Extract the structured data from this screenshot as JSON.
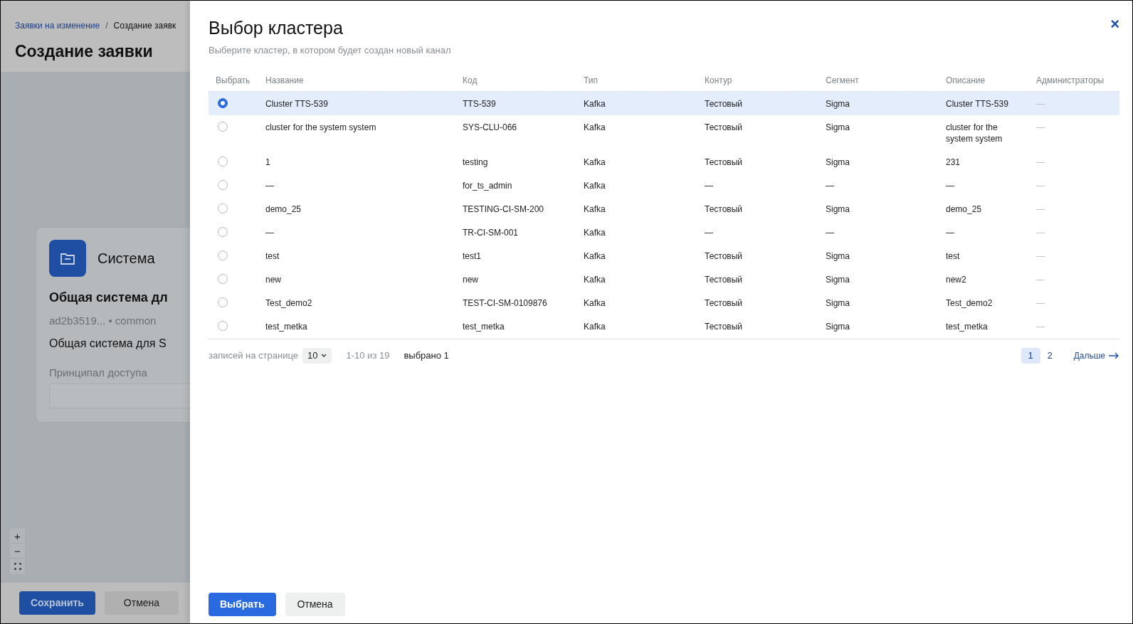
{
  "background_page": {
    "breadcrumbs": [
      {
        "label": "Заявки на изменение",
        "link": true
      },
      {
        "label": "Создание заявк",
        "link": false
      }
    ],
    "breadcrumb_separator": "/",
    "title": "Создание заявки",
    "card": {
      "kind_label": "Система",
      "name": "Общая система дл",
      "meta": "ad2b3519... • common",
      "description": "Общая система для S",
      "field_label": "Принципал доступа"
    },
    "map_controls": [
      "+",
      "−"
    ],
    "buttons": [
      {
        "label": "Сохранить",
        "kind": "primary"
      },
      {
        "label": "Отмена",
        "kind": "secondary"
      }
    ]
  },
  "drawer": {
    "title": "Выбор кластера",
    "subtitle": "Выберите кластер, в котором будет создан новый канал",
    "close": "×",
    "table": {
      "select_header": "Выбрать",
      "columns": [
        "Название",
        "Код",
        "Тип",
        "Контур",
        "Сегмент",
        "Описание",
        "Администраторы"
      ],
      "rows": [
        {
          "selected": true,
          "cells": [
            "Cluster TTS-539",
            "TTS-539",
            "Kafka",
            "Тестовый",
            "Sigma",
            "Cluster TTS-539",
            "—"
          ]
        },
        {
          "selected": false,
          "cells": [
            "cluster for the system system",
            "SYS-CLU-066",
            "Kafka",
            "Тестовый",
            "Sigma",
            "cluster for the system system",
            "—"
          ]
        },
        {
          "selected": false,
          "cells": [
            "1",
            "testing",
            "Kafka",
            "Тестовый",
            "Sigma",
            "231",
            "—"
          ]
        },
        {
          "selected": false,
          "cells": [
            "—",
            "for_ts_admin",
            "Kafka",
            "—",
            "—",
            "—",
            "—"
          ]
        },
        {
          "selected": false,
          "cells": [
            "demo_25",
            "TESTING-CI-SM-200",
            "Kafka",
            "Тестовый",
            "Sigma",
            "demo_25",
            "—"
          ]
        },
        {
          "selected": false,
          "cells": [
            "—",
            "TR-CI-SM-001",
            "Kafka",
            "—",
            "—",
            "—",
            "—"
          ]
        },
        {
          "selected": false,
          "cells": [
            "test",
            "test1",
            "Kafka",
            "Тестовый",
            "Sigma",
            "test",
            "—"
          ]
        },
        {
          "selected": false,
          "cells": [
            "new",
            "new",
            "Kafka",
            "Тестовый",
            "Sigma",
            "new2",
            "—"
          ]
        },
        {
          "selected": false,
          "cells": [
            "Test_demo2",
            "TEST-CI-SM-0109876",
            "Kafka",
            "Тестовый",
            "Sigma",
            "Test_demo2",
            "—"
          ]
        },
        {
          "selected": false,
          "cells": [
            "test_metka",
            "test_metka",
            "Kafka",
            "Тестовый",
            "Sigma",
            "test_metka",
            "—"
          ]
        }
      ]
    },
    "pagination": {
      "per_page_label": "записей на странице",
      "per_page": "10",
      "range": "1-10 из 19",
      "selected_count": "выбрано 1",
      "pages": [
        {
          "label": "1",
          "selected": true
        },
        {
          "label": "2",
          "selected": false
        }
      ],
      "next": "Дальше"
    },
    "buttons": [
      {
        "label": "Выбрать",
        "kind": "primary"
      },
      {
        "label": "Отмена",
        "kind": "secondary"
      }
    ]
  }
}
